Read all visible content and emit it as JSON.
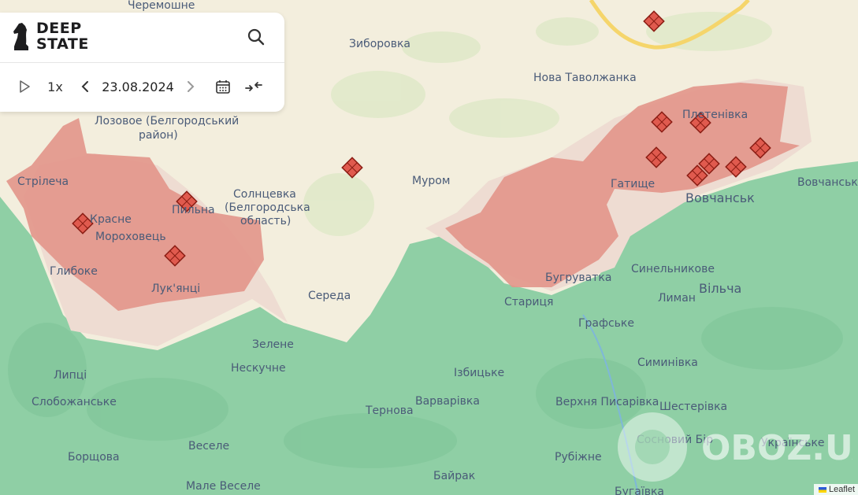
{
  "app": {
    "logo_line1": "DEEP",
    "logo_line2": "STATE",
    "speed_label": "1x",
    "date": "23.08.2024"
  },
  "colors": {
    "land_neutral": "#f3eedd",
    "ukraine_control": "#8fcfa5",
    "occupied": "#e2958a",
    "grey_zone": "#eedcd2",
    "border_yellow": "#f5d56b"
  },
  "icons": [
    "play-icon",
    "chevron-left-icon",
    "chevron-right-icon",
    "calendar-icon",
    "compress-icon",
    "search-icon",
    "knight-logo-icon",
    "conflict-marker-icon"
  ],
  "places": {
    "cheremoshne": "Черемошне",
    "zyborivka": "Зиборовка",
    "nova_tavolzhanka": "Нова Таволжанка",
    "lozove_1": "Лозовое (Белгородський",
    "lozove_2": "район)",
    "strilecha": "Стрілеча",
    "krasne": "Красне",
    "pylna": "Пильна",
    "solntsevka_1": "Солнцевка",
    "solntsevka_2": "(Белгородська",
    "solntsevka_3": "область)",
    "murom": "Муром",
    "pletenivka": "Плетенівка",
    "hatyshche": "Гатище",
    "vovchansk": "Вовчанськ",
    "vovchanski": "Вовчанські",
    "morokhovets": "Мороховець",
    "hlyboke": "Глибоке",
    "lukiantsi": "Лук'янці",
    "sereda": "Середа",
    "buhruvatka": "Бугруватка",
    "starytsia": "Стариця",
    "synelnykove": "Синельникове",
    "lyman": "Лиман",
    "vilcha": "Вільча",
    "hrafske": "Графське",
    "zelene": "Зелене",
    "neskuchne": "Нескучне",
    "izbytske": "Ізбицьке",
    "syminivka": "Симинівка",
    "lyptsi": "Липці",
    "slobozhanske": "Слобожанське",
    "ternova": "Тернова",
    "varvarivka": "Варварівка",
    "verkhnia_pysarivka": "Верхня Писарівка",
    "shesterivka": "Шестерівка",
    "sosnovyi_bir": "Сосновий Бір",
    "ukrainske": "Українське",
    "borshchova": "Борщова",
    "vesele": "Веселе",
    "rubizhne": "Рубіжне",
    "male_vesele": "Мале Веселе",
    "baiarak": "Байрак",
    "buhaivka": "Бугаївка"
  },
  "watermark": "OBOZ.UA",
  "attribution": "Leaflet"
}
